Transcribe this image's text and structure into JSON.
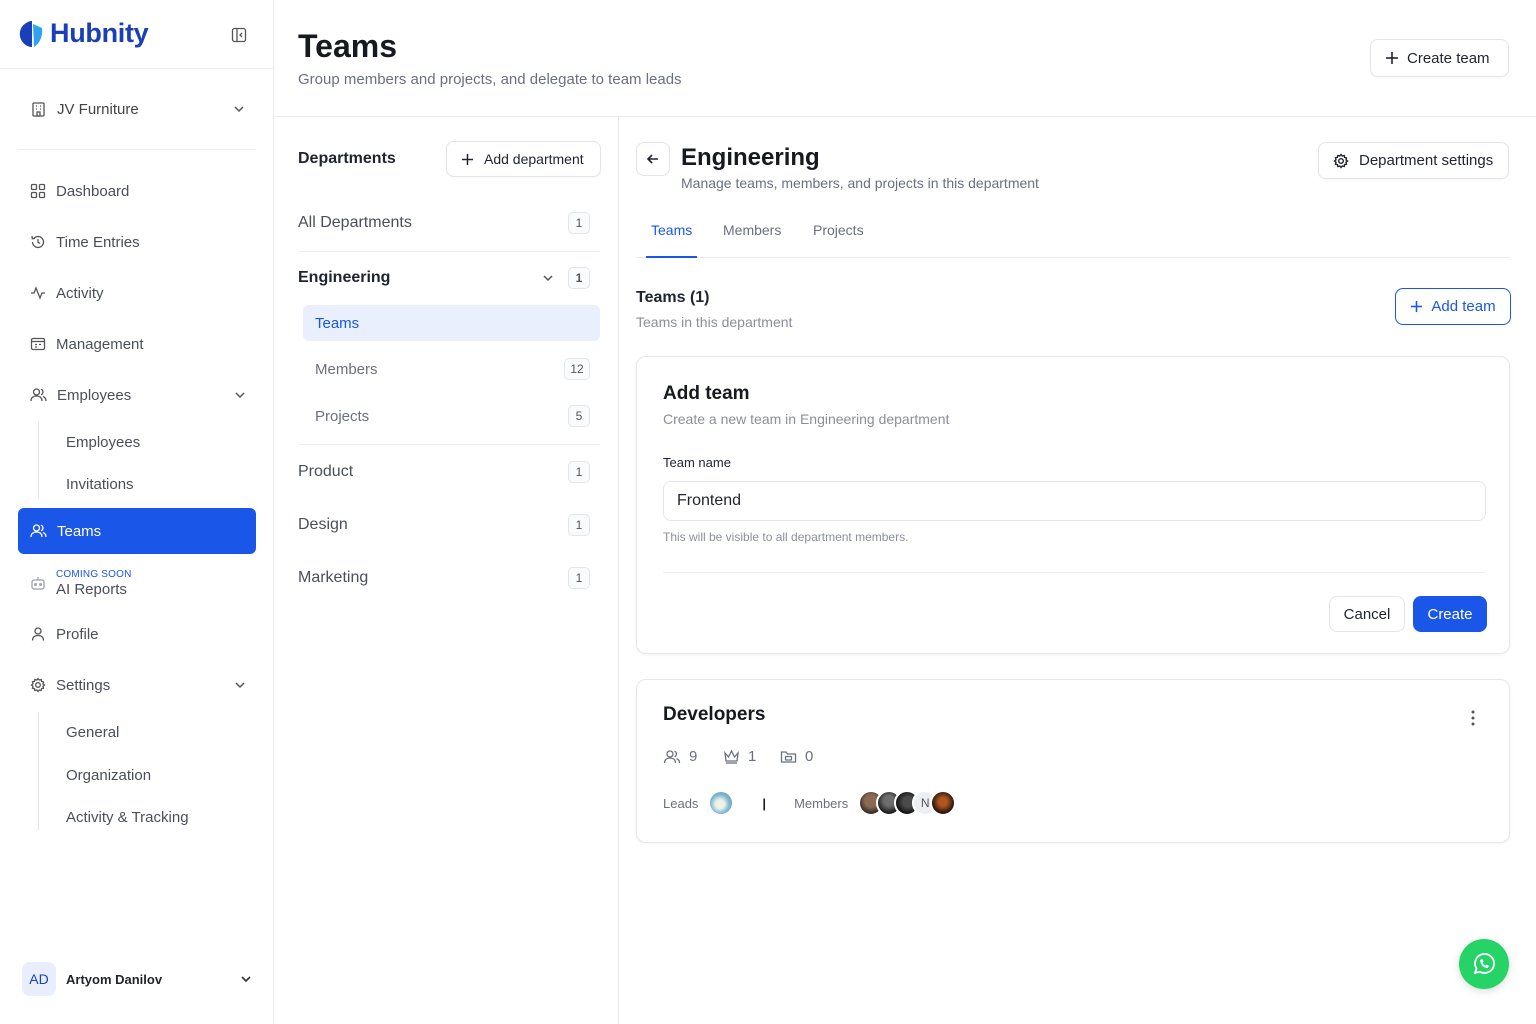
{
  "brand": {
    "name": "Hubnity"
  },
  "org": {
    "name": "JV Furniture"
  },
  "nav": {
    "dashboard": "Dashboard",
    "time_entries": "Time Entries",
    "activity": "Activity",
    "management": "Management",
    "employees": "Employees",
    "employees_sub": [
      "Employees",
      "Invitations"
    ],
    "teams": "Teams",
    "ai_badge": "COMING SOON",
    "ai_reports": "AI Reports",
    "profile": "Profile",
    "settings": "Settings",
    "settings_sub": [
      "General",
      "Organization",
      "Activity & Tracking"
    ]
  },
  "user": {
    "initials": "AD",
    "name": "Artyom Danilov"
  },
  "header": {
    "title": "Teams",
    "subtitle": "Group members and projects, and delegate to team leads",
    "create_team": "Create team"
  },
  "departments": {
    "title": "Departments",
    "add_label": "Add department",
    "all": {
      "label": "All Departments",
      "count": "1"
    },
    "engineering": {
      "label": "Engineering",
      "count": "1",
      "sub": [
        {
          "label": "Teams",
          "count": ""
        },
        {
          "label": "Members",
          "count": "12"
        },
        {
          "label": "Projects",
          "count": "5"
        }
      ]
    },
    "others": [
      {
        "label": "Product",
        "count": "1"
      },
      {
        "label": "Design",
        "count": "1"
      },
      {
        "label": "Marketing",
        "count": "1"
      }
    ]
  },
  "detail": {
    "title": "Engineering",
    "subtitle": "Manage teams, members, and projects in this department",
    "settings_label": "Department settings",
    "tabs": [
      "Teams",
      "Members",
      "Projects"
    ],
    "teams_heading": "Teams (1)",
    "teams_sub": "Teams in this department",
    "add_team_label": "Add team"
  },
  "add_team_form": {
    "title": "Add team",
    "subtitle": "Create a new team in Engineering department",
    "field_label": "Team name",
    "value": "Frontend",
    "helper": "This will be visible to all department members.",
    "cancel": "Cancel",
    "create": "Create"
  },
  "team_card": {
    "name": "Developers",
    "members_count": "9",
    "leads_count": "1",
    "projects_count": "0",
    "leads_label": "Leads",
    "separator": "|",
    "members_label": "Members",
    "avatar_text": "N"
  },
  "colors": {
    "accent": "#1a56e8",
    "brand": "#1a3fb8",
    "whatsapp": "#25d366"
  }
}
